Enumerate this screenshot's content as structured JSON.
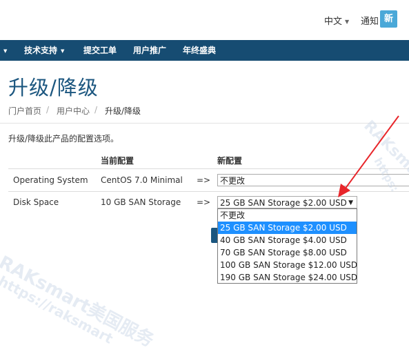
{
  "header": {
    "lang_label": "中文",
    "notice_label": "通知",
    "badge_text": "新"
  },
  "nav": {
    "items": [
      {
        "label": "技术支持",
        "has_caret": true
      },
      {
        "label": "提交工单"
      },
      {
        "label": "用户推广"
      },
      {
        "label": "年终盛典"
      }
    ]
  },
  "page": {
    "title": "升级/降级",
    "breadcrumb": [
      "门户首页",
      "用户中心",
      "升级/降级"
    ],
    "intro": "升级/降级此产品的配置选项。"
  },
  "table": {
    "headers": {
      "current": "当前配置",
      "new": "新配置"
    },
    "rows": [
      {
        "name": "Operating System",
        "current": "CentOS 7.0 Minimal",
        "arrow": "=>",
        "selected": "不更改"
      },
      {
        "name": "Disk Space",
        "current": "10 GB SAN Storage",
        "arrow": "=>",
        "selected": "25 GB SAN Storage $2.00 USD"
      }
    ]
  },
  "dropdown": {
    "options": [
      "不更改",
      "25 GB SAN Storage $2.00 USD",
      "40 GB SAN Storage $4.00 USD",
      "70 GB SAN Storage $8.00 USD",
      "100 GB SAN Storage $12.00 USD",
      "190 GB SAN Storage $24.00 USD"
    ],
    "selected_index": 1
  },
  "watermark": {
    "text1": "RAKsmart美国服务",
    "text2": "https://raksmart",
    "text3": "RAKsmart",
    "text4": "https:"
  },
  "colors": {
    "nav_bg": "#164c72",
    "title": "#1b567f",
    "badge": "#4aa8d8",
    "selected_option": "#1e90ff",
    "arrow": "#e8262b"
  }
}
